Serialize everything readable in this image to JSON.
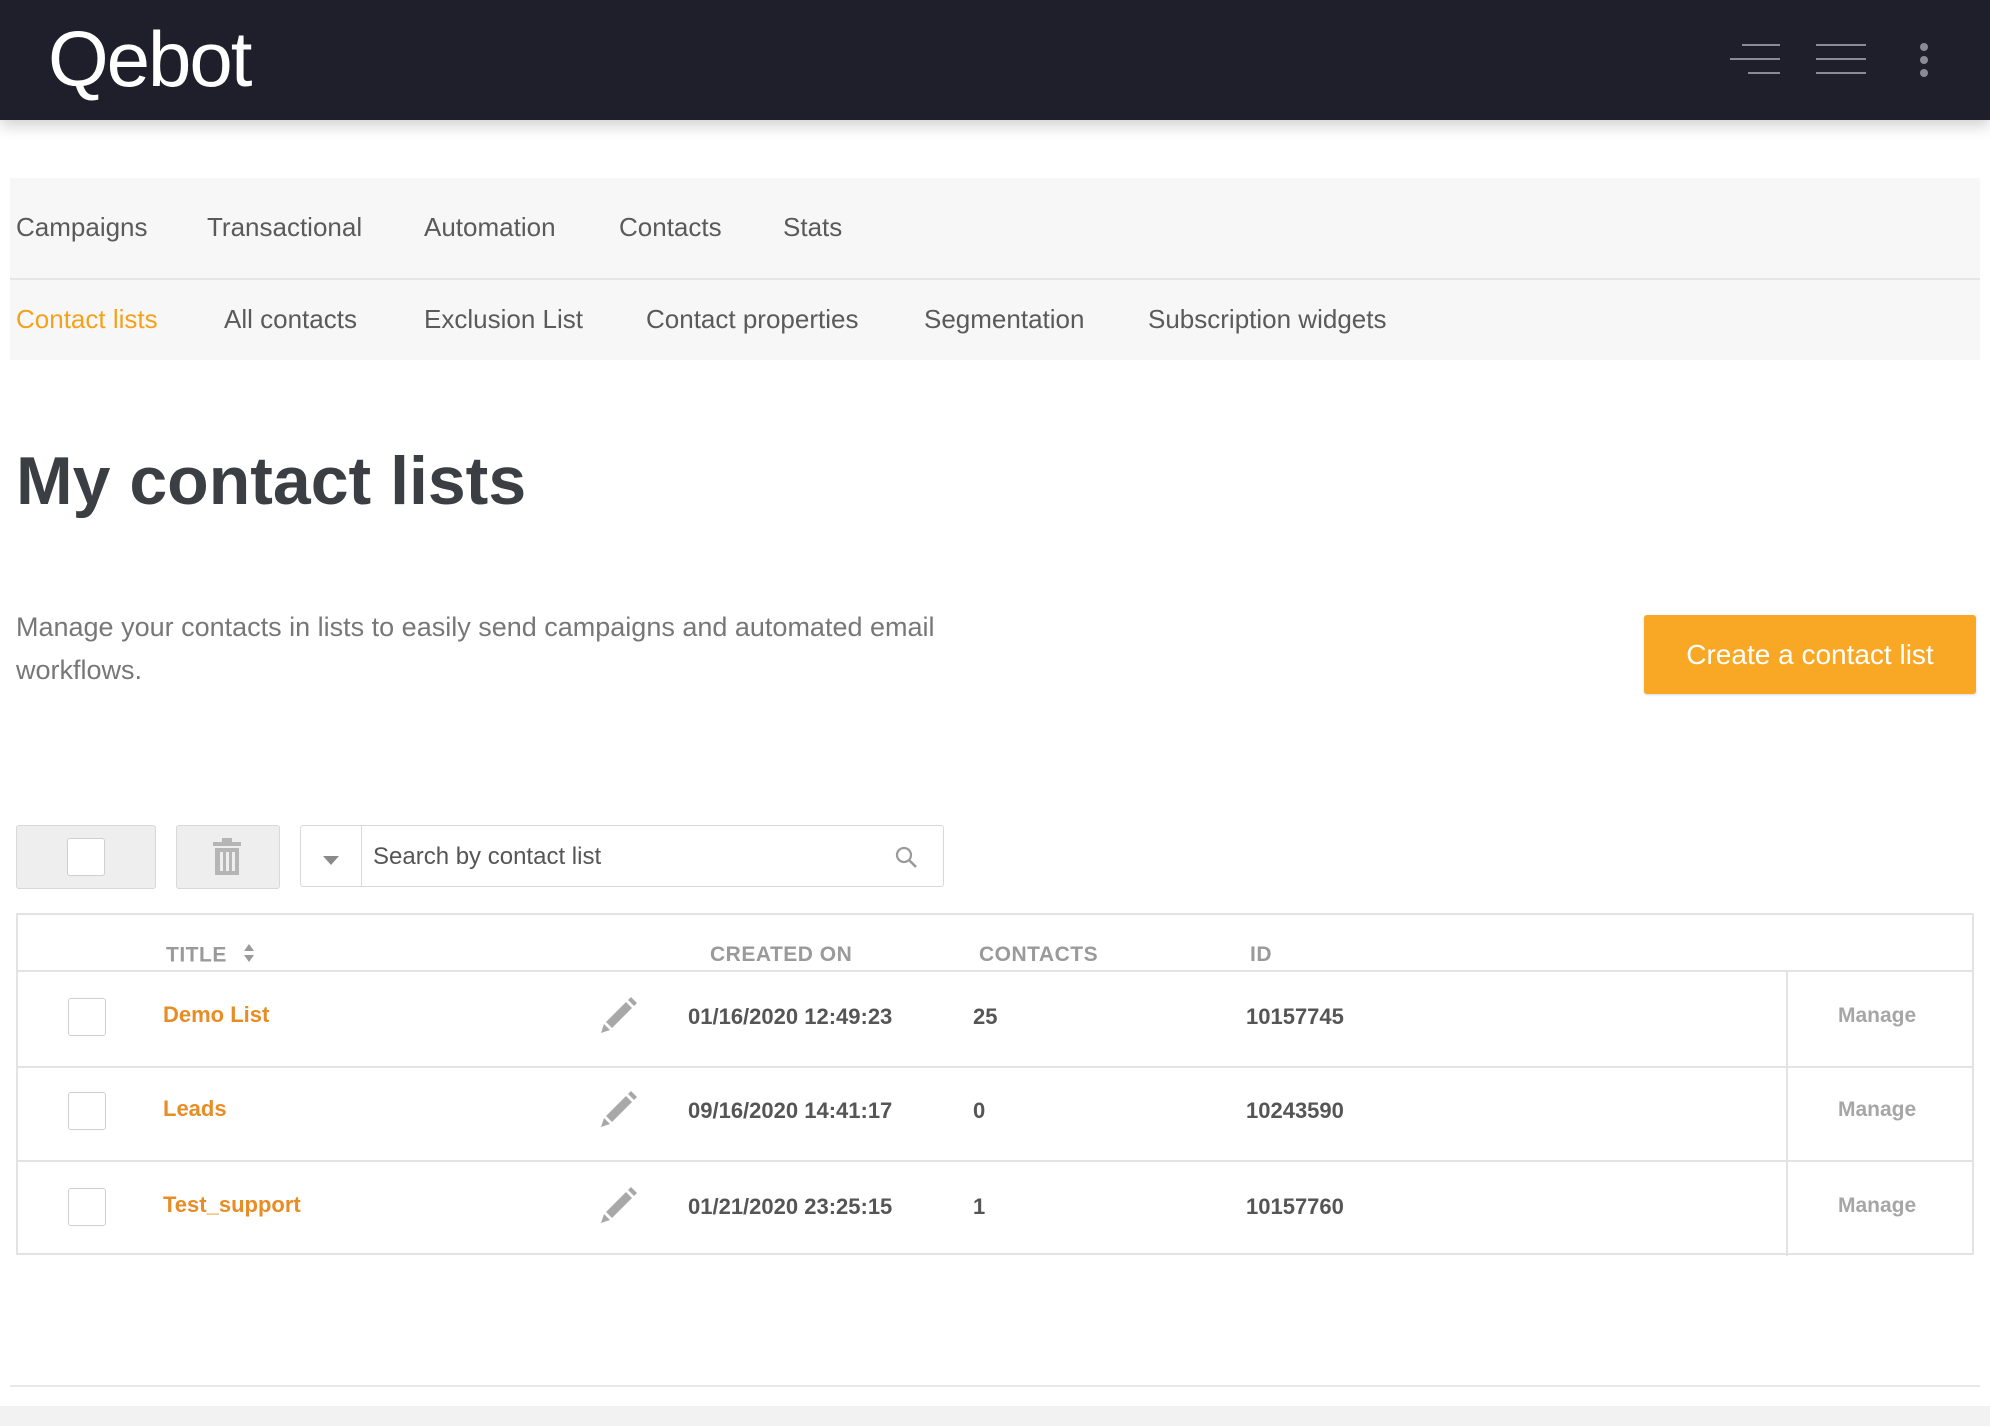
{
  "app": {
    "logo": "Qebot"
  },
  "nav": {
    "primary": [
      {
        "label": "Campaigns"
      },
      {
        "label": "Transactional"
      },
      {
        "label": "Automation"
      },
      {
        "label": "Contacts"
      },
      {
        "label": "Stats"
      }
    ],
    "secondary": [
      {
        "label": "Contact lists",
        "active": true
      },
      {
        "label": "All contacts"
      },
      {
        "label": "Exclusion List"
      },
      {
        "label": "Contact properties"
      },
      {
        "label": "Segmentation"
      },
      {
        "label": "Subscription widgets"
      }
    ]
  },
  "page": {
    "title": "My contact lists",
    "description": "Manage your contacts in lists to easily send campaigns and automated email workflows.",
    "create_button": "Create a contact list"
  },
  "toolbar": {
    "search_placeholder": "Search by contact list"
  },
  "table": {
    "headers": {
      "title": "TITLE",
      "created_on": "CREATED ON",
      "contacts": "CONTACTS",
      "id": "ID"
    },
    "rows": [
      {
        "title": "Demo List",
        "created_on": "01/16/2020 12:49:23",
        "contacts": "25",
        "id": "10157745",
        "action": "Manage"
      },
      {
        "title": "Leads",
        "created_on": "09/16/2020 14:41:17",
        "contacts": "0",
        "id": "10243590",
        "action": "Manage"
      },
      {
        "title": "Test_support",
        "created_on": "01/21/2020 23:25:15",
        "contacts": "1",
        "id": "10157760",
        "action": "Manage"
      }
    ]
  },
  "colors": {
    "accent": "#f9a825",
    "link": "#e88c25",
    "topbar": "#1f1f2b"
  },
  "icons": [
    "lines-icon",
    "menu-icon",
    "more-vertical-icon",
    "trash-icon",
    "chevron-down-icon",
    "search-icon",
    "pencil-icon",
    "sort-icon"
  ]
}
